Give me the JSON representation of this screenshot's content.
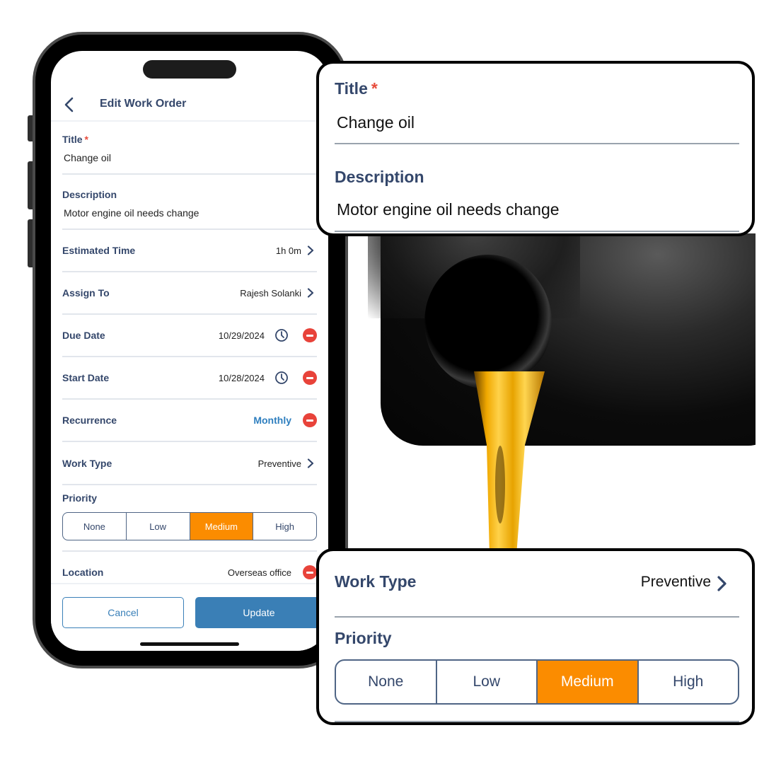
{
  "app": {
    "header_title": "Edit Work Order",
    "back_icon": "chevron-left-icon"
  },
  "form": {
    "title": {
      "label": "Title",
      "required_mark": "*",
      "value": "Change oil"
    },
    "description": {
      "label": "Description",
      "value": "Motor engine oil needs change"
    },
    "estimated_time": {
      "label": "Estimated Time",
      "value": "1h 0m"
    },
    "assign_to": {
      "label": "Assign To",
      "value": "Rajesh Solanki"
    },
    "due_date": {
      "label": "Due Date",
      "value": "10/29/2024"
    },
    "start_date": {
      "label": "Start Date",
      "value": "10/28/2024"
    },
    "recurrence": {
      "label": "Recurrence",
      "value": "Monthly"
    },
    "work_type": {
      "label": "Work Type",
      "value": "Preventive"
    },
    "priority": {
      "label": "Priority",
      "options": [
        "None",
        "Low",
        "Medium",
        "High"
      ],
      "selected": "Medium"
    },
    "location": {
      "label": "Location",
      "value": "Overseas office"
    }
  },
  "footer": {
    "cancel_label": "Cancel",
    "update_label": "Update"
  },
  "colors": {
    "label": "#34476b",
    "accent_blue": "#3a7fb6",
    "priority_active": "#fb8c00",
    "remove_red": "#e8433a",
    "required_red": "#e74c3c"
  }
}
